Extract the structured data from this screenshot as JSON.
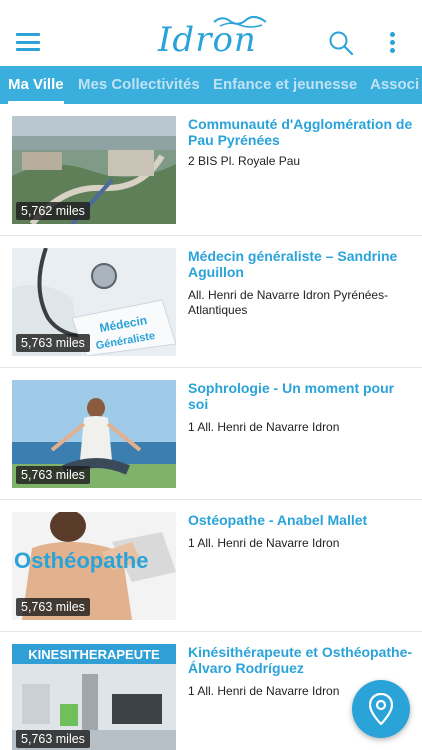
{
  "app": {
    "logo_text": "Idron"
  },
  "icons": {
    "menu": "hamburger-menu-icon",
    "search": "search-icon",
    "more": "more-vertical-icon",
    "map": "map-pin-icon"
  },
  "colors": {
    "accent": "#2aa3d9",
    "tabbar": "#3aaedc"
  },
  "tabs": [
    {
      "label": "Ma Ville",
      "active": true
    },
    {
      "label": "Mes Collectivités",
      "active": false
    },
    {
      "label": "Enfance et jeunesse",
      "active": false
    },
    {
      "label": "Associ",
      "active": false
    }
  ],
  "items": [
    {
      "title": "Communauté d'Agglomération de Pau Pyrénées",
      "address": "2 BIS Pl. Royale Pau",
      "distance": "5,762 miles",
      "image": "aerial-city-photo"
    },
    {
      "title": "Médecin généraliste – Sandrine Aguillon",
      "address": "All. Henri de Navarre Idron Pyrénées-Atlantiques",
      "distance": "5,763 miles",
      "image": "stethoscope-photo",
      "image_caption": "Médecin Généraliste"
    },
    {
      "title": "Sophrologie - Un moment pour soi",
      "address": "1 All. Henri de Navarre Idron",
      "distance": "5,763 miles",
      "image": "meditation-beach-photo"
    },
    {
      "title": "Ostéopathe - Anabel Mallet",
      "address": "1 All. Henri de Navarre Idron",
      "distance": "5,763 miles",
      "image": "osteopath-photo",
      "image_caption": "Osthéopathe"
    },
    {
      "title": "Kinésithérapeute et Osthéopathe- Álvaro Rodríguez",
      "address": "1 All. Henri de Navarre Idron",
      "distance": "5,763 miles",
      "image": "physio-room-photo",
      "image_caption": "KINESITHERAPEUTE"
    }
  ]
}
